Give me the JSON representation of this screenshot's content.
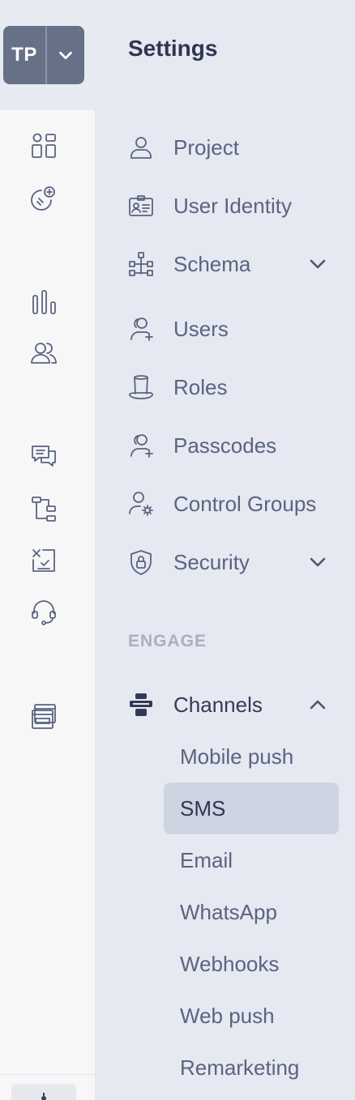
{
  "workspace": {
    "initials": "TP"
  },
  "panel": {
    "title": "Settings"
  },
  "nav": {
    "project": "Project",
    "user_identity": "User Identity",
    "schema": "Schema",
    "users": "Users",
    "roles": "Roles",
    "passcodes": "Passcodes",
    "control_groups": "Control Groups",
    "security": "Security"
  },
  "engage": {
    "section_label": "ENGAGE",
    "channels": "Channels",
    "sub_items": [
      "Mobile push",
      "SMS",
      "Email",
      "WhatsApp",
      "Webhooks",
      "Web push",
      "Remarketing"
    ],
    "active": "SMS"
  },
  "rail_icons": [
    "dashboard-icon",
    "analytics-tag-icon",
    "bar-chart-icon",
    "users-icon",
    "messages-icon",
    "flows-icon",
    "reports-icon",
    "support-headset-icon",
    "web-browser-icon",
    "settings-icon"
  ],
  "colors": {
    "rail_bg": "#f7f7f8",
    "panel_bg": "#e6e9f1",
    "avatar_bg": "#667086",
    "active_bg": "#ced5e2"
  }
}
